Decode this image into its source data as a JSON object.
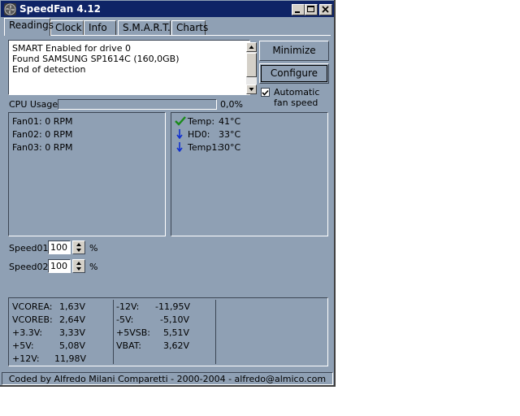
{
  "window": {
    "title": "SpeedFan 4.12"
  },
  "tabs": [
    {
      "label": "Readings",
      "active": true
    },
    {
      "label": "Clock",
      "active": false
    },
    {
      "label": "Info",
      "active": false
    },
    {
      "label": "S.M.A.R.T.",
      "active": false
    },
    {
      "label": "Charts",
      "active": false
    }
  ],
  "log": {
    "lines": [
      "SMART Enabled for drive 0",
      "Found SAMSUNG SP1614C (160,0GB)",
      "End of detection"
    ]
  },
  "buttons": {
    "minimize": "Minimize",
    "configure": "Configure"
  },
  "auto_fan": {
    "label_line1": "Automatic",
    "label_line2": "fan speed",
    "checked": true
  },
  "cpu": {
    "label": "CPU Usage",
    "value": "0,0%",
    "fraction": 0.0
  },
  "fans": [
    {
      "label": "Fan01:",
      "value": "0 RPM"
    },
    {
      "label": "Fan02:",
      "value": "0 RPM"
    },
    {
      "label": "Fan03:",
      "value": "0 RPM"
    }
  ],
  "temps": [
    {
      "label": "Temp:",
      "value": "41°C",
      "icon": "check-icon",
      "color": "#1a8a1a"
    },
    {
      "label": "HD0:",
      "value": "33°C",
      "icon": "arrow-down-icon",
      "color": "#1030d0"
    },
    {
      "label": "Temp1:",
      "value": "30°C",
      "icon": "arrow-down-icon",
      "color": "#1030d0"
    }
  ],
  "speeds": [
    {
      "label": "Speed01:",
      "value": "100",
      "unit": "%"
    },
    {
      "label": "Speed02:",
      "value": "100",
      "unit": "%"
    }
  ],
  "voltages_left": [
    {
      "label": "VCOREA:",
      "value": "1,63V"
    },
    {
      "label": "VCOREB:",
      "value": "2,64V"
    },
    {
      "label": "+3.3V:",
      "value": "3,33V"
    },
    {
      "label": "+5V:",
      "value": "5,08V"
    },
    {
      "label": "+12V:",
      "value": "11,98V"
    }
  ],
  "voltages_mid": [
    {
      "label": "-12V:",
      "value": "-11,95V"
    },
    {
      "label": "-5V:",
      "value": "-5,10V"
    },
    {
      "label": "+5VSB:",
      "value": "5,51V"
    },
    {
      "label": "VBAT:",
      "value": "3,62V"
    }
  ],
  "footer": "Coded by Alfredo Milani Comparetti - 2000-2004 - alfredo@almico.com"
}
